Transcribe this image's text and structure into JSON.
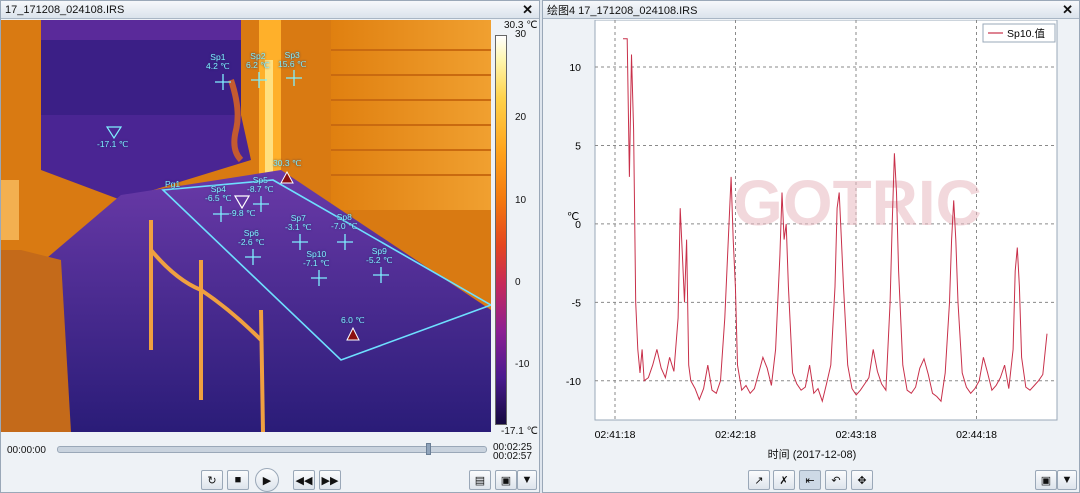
{
  "left_pane": {
    "title": "17_171208_024108.IRS",
    "close": "✕",
    "scale": {
      "max": "30.3 ℃",
      "min": "-17.1 ℃",
      "ticks": [
        "30",
        "20",
        "10",
        "0",
        "-10"
      ]
    },
    "spots": [
      {
        "name": "Sp1",
        "temp": "4.2 ℃"
      },
      {
        "name": "Sp2",
        "temp": "6.2 ℃"
      },
      {
        "name": "Sp3",
        "temp": "15.6 ℃"
      },
      {
        "name": "Sp4",
        "temp": "-6.5 ℃"
      },
      {
        "name": "Sp5",
        "temp": "-8.7 ℃"
      },
      {
        "name": "Sp6",
        "temp": "-2.6 ℃"
      },
      {
        "name": "Sp7",
        "temp": "-3.1 ℃"
      },
      {
        "name": "Sp8",
        "temp": "-7.0 ℃"
      },
      {
        "name": "Sp9",
        "temp": "-5.2 ℃"
      },
      {
        "name": "Sp10",
        "temp": "-7.1 ℃"
      }
    ],
    "cold_marker": "-17.1 ℃",
    "hot_marker": "30.3 ℃",
    "poly_min": "-9.8 ℃",
    "poly_max": "6.0 ℃",
    "poly_name": "Pg1",
    "timeline": {
      "start": "00:00:00",
      "current": "00:02:25",
      "end": "00:02:57"
    }
  },
  "right_pane": {
    "title": "绘图4 17_171208_024108.IRS",
    "close": "✕",
    "watermark": "GOTRIC"
  },
  "chart_data": {
    "type": "line",
    "xlabel": "时间 (2017-12-08)",
    "ylabel": "℃",
    "x_ticks": [
      "02:41:18",
      "02:42:18",
      "02:43:18",
      "02:44:18"
    ],
    "y_ticks": [
      10,
      5,
      0,
      -5,
      -10
    ],
    "ylim": [
      -12.5,
      13
    ],
    "xlim_seconds": [
      0,
      200
    ],
    "grid": true,
    "legend_position": "top-right",
    "colors": {
      "series": "#c8304a"
    },
    "series": [
      {
        "name": "Sp10.值",
        "x": [
          0,
          2,
          3,
          4,
          5,
          6,
          7,
          8,
          9,
          10,
          12,
          14,
          16,
          18,
          20,
          22,
          24,
          26,
          27,
          28,
          29,
          30,
          31,
          32,
          34,
          36,
          38,
          40,
          42,
          44,
          46,
          48,
          50,
          51,
          52,
          53,
          54,
          56,
          58,
          60,
          62,
          64,
          66,
          68,
          70,
          72,
          74,
          75,
          76,
          77,
          78,
          80,
          82,
          84,
          86,
          88,
          90,
          92,
          94,
          96,
          98,
          100,
          101,
          102,
          103,
          104,
          106,
          108,
          110,
          112,
          114,
          116,
          118,
          120,
          122,
          124,
          126,
          127,
          128,
          129,
          130,
          132,
          134,
          136,
          138,
          140,
          142,
          144,
          146,
          148,
          150,
          152,
          154,
          155,
          156,
          157,
          158,
          160,
          162,
          164,
          166,
          168,
          170,
          172,
          174,
          176,
          178,
          180,
          182,
          184,
          185,
          186,
          187,
          188,
          190,
          192,
          194,
          196,
          198,
          200
        ],
        "values": [
          11.8,
          11.8,
          3,
          10.8,
          6,
          -5,
          -8,
          -9.5,
          -8,
          -10,
          -9.8,
          -9,
          -8,
          -9.2,
          -9.8,
          -8.5,
          -9.4,
          -6,
          1,
          -2,
          -5,
          -1,
          -9,
          -10,
          -10.5,
          -11.2,
          -10.5,
          -9,
          -10.6,
          -10.8,
          -10,
          -6,
          0,
          3,
          -1,
          -4,
          -9,
          -10.6,
          -10.3,
          -10.8,
          -10.5,
          -9.5,
          -8.5,
          -9.2,
          -10.3,
          -8,
          -2,
          2,
          -1,
          0,
          -4,
          -9.5,
          -10.2,
          -10.6,
          -10.4,
          -9,
          -10.8,
          -10.5,
          -11.3,
          -10.2,
          -9,
          -4,
          1,
          2,
          -1,
          -4,
          -9,
          -10.5,
          -10.9,
          -10.6,
          -10.2,
          -9.8,
          -8,
          -9.4,
          -10.2,
          -10.6,
          -5,
          0,
          4.5,
          2,
          -3,
          -9,
          -10.6,
          -10.8,
          -10.4,
          -9.2,
          -8.6,
          -9.6,
          -10.8,
          -11,
          -11.3,
          -9.5,
          -5,
          -1,
          1.5,
          -1,
          -5,
          -9.5,
          -10.4,
          -10.8,
          -10.5,
          -10,
          -8.5,
          -9.5,
          -10.6,
          -10.3,
          -9.8,
          -9,
          -10.5,
          -8,
          -3,
          -1.5,
          -4,
          -8.5,
          -10.4,
          -10.6,
          -10.3,
          -10,
          -9.6,
          -7
        ]
      }
    ]
  }
}
